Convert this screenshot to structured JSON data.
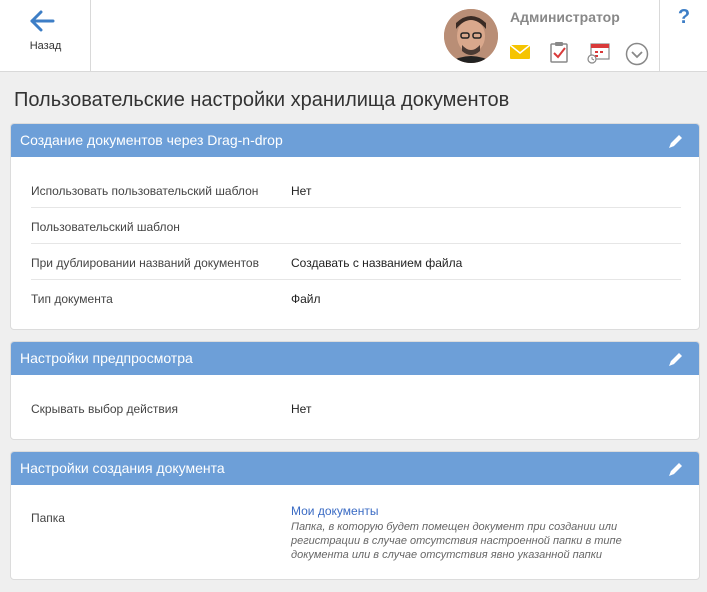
{
  "header": {
    "back_label": "Назад",
    "user_name": "Администратор",
    "help_label": "?"
  },
  "page": {
    "title": "Пользовательские настройки хранилища документов"
  },
  "panels": [
    {
      "title": "Создание документов через Drag-n-drop",
      "rows": [
        {
          "label": "Использовать пользовательский шаблон",
          "value": "Нет"
        },
        {
          "label": "Пользовательский шаблон",
          "value": ""
        },
        {
          "label": "При дублировании названий документов",
          "value": "Создавать с названием файла"
        },
        {
          "label": "Тип документа",
          "value": "Файл"
        }
      ]
    },
    {
      "title": "Настройки предпросмотра",
      "rows": [
        {
          "label": "Скрывать выбор действия",
          "value": "Нет"
        }
      ]
    },
    {
      "title": "Настройки создания документа",
      "rows": [
        {
          "label": "Папка",
          "link": "Мои документы",
          "note": "Папка, в которую будет помещен документ при создании или регистрации в случае отсутствия настроенной папки в типе документа или в случае отсутствия явно указанной папки"
        }
      ]
    }
  ],
  "colors": {
    "panel_header": "#6d9fd8",
    "accent": "#3d7ec6",
    "mail": "#f5c400",
    "task": "#d93a3a"
  }
}
